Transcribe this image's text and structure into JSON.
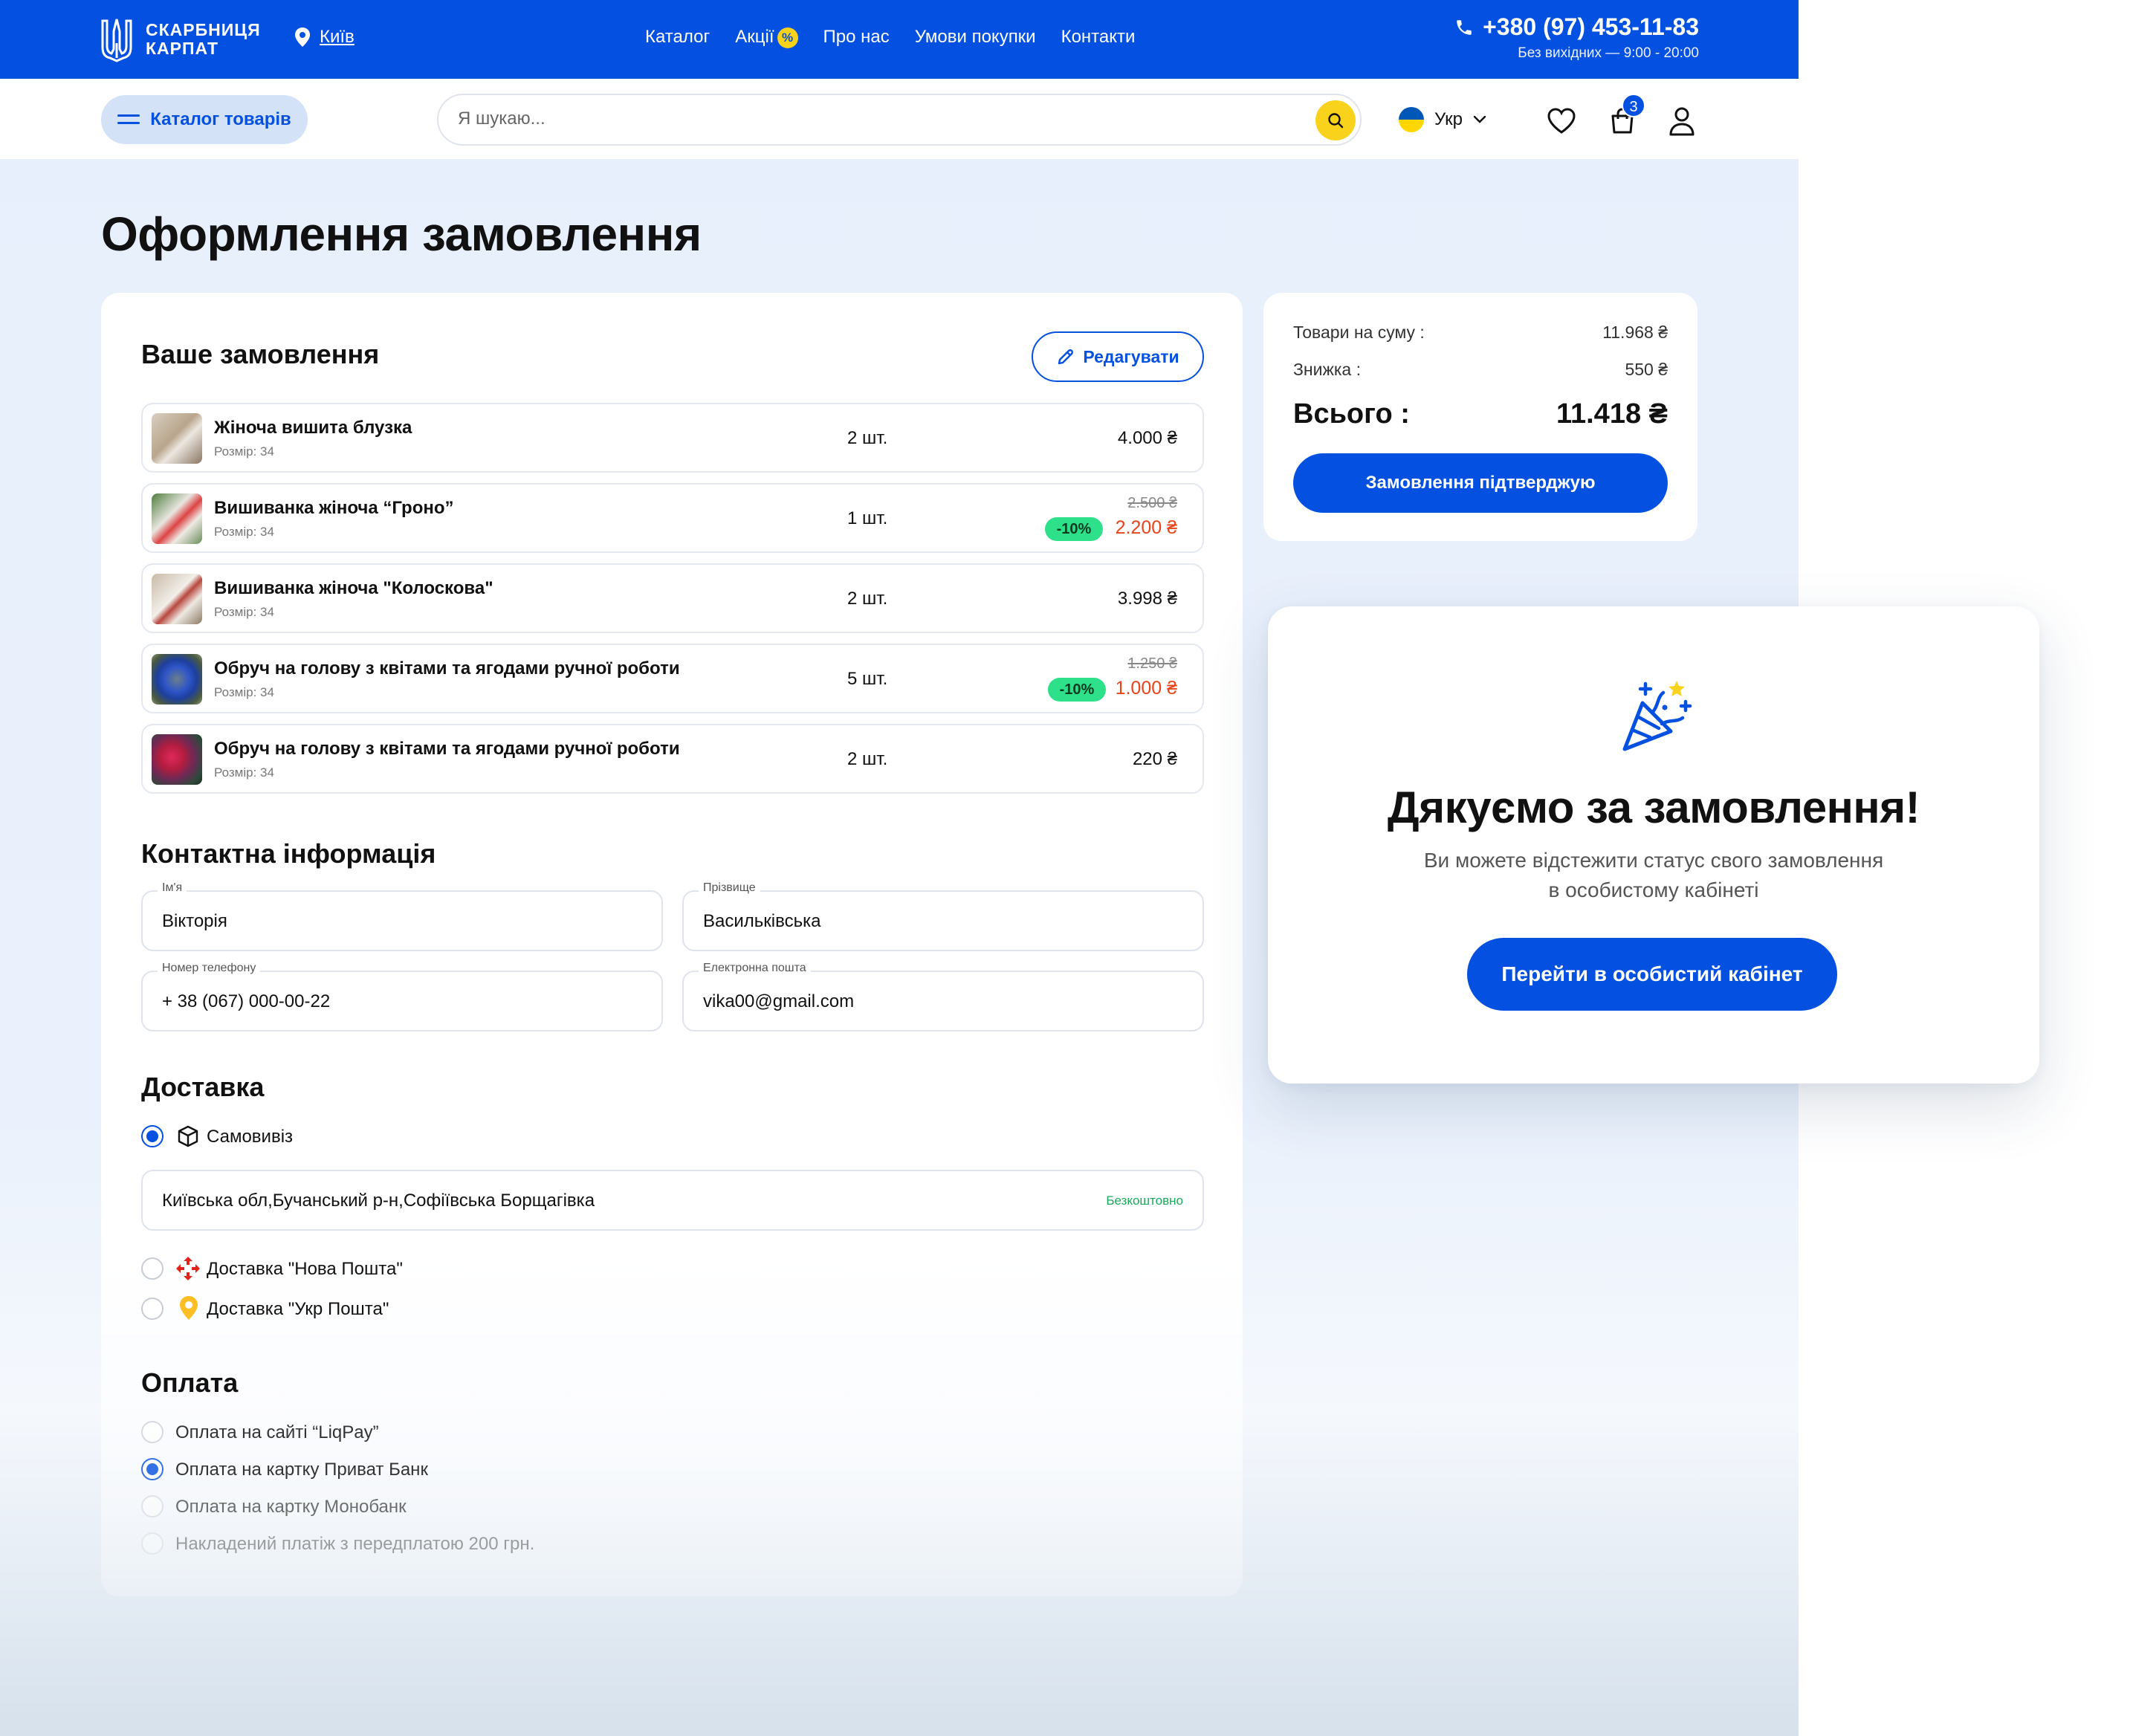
{
  "header": {
    "logo_line1": "СКАРБНИЦЯ",
    "logo_line2": "КАРПАТ",
    "city": "Київ",
    "nav": [
      "Каталог",
      "Акції",
      "Про нас",
      "Умови покупки",
      "Контакти"
    ],
    "sale_badge": "%",
    "phone": "+380 (97) 453-11-83",
    "hours": "Без вихідних — 9:00 - 20:00"
  },
  "toolbar": {
    "catalog_button": "Каталог товарів",
    "search_placeholder": "Я шукаю...",
    "language": "Укр",
    "cart_count": "3"
  },
  "page_title": "Оформлення замовлення",
  "order": {
    "title": "Ваше замовлення",
    "edit_button": "Редагувати",
    "items": [
      {
        "name": "Жіноча вишита блузка",
        "size": "Розмір: 34",
        "qty": "2 шт.",
        "price": "4.000 ₴",
        "old_price": "",
        "discount": ""
      },
      {
        "name": "Вишиванка жіноча “Гроно”",
        "size": "Розмір: 34",
        "qty": "1 шт.",
        "price": "2.200 ₴",
        "old_price": "2.500 ₴",
        "discount": "-10%"
      },
      {
        "name": "Вишиванка жіноча \"Колоскова\"",
        "size": "Розмір: 34",
        "qty": "2 шт.",
        "price": "3.998 ₴",
        "old_price": "",
        "discount": ""
      },
      {
        "name": "Обруч на голову з квітами та ягодами ручної роботи",
        "size": "Розмір: 34",
        "qty": "5 шт.",
        "price": "1.000 ₴",
        "old_price": "1.250 ₴",
        "discount": "-10%"
      },
      {
        "name": "Обруч на голову з квітами та ягодами ручної роботи",
        "size": "Розмір: 34",
        "qty": "2 шт.",
        "price": "220 ₴",
        "old_price": "",
        "discount": ""
      }
    ]
  },
  "contact": {
    "title": "Контактна інформація",
    "first_name_label": "Ім'я",
    "first_name": "Вікторія",
    "last_name_label": "Прізвище",
    "last_name": "Васильківська",
    "phone_label": "Номер телефону",
    "phone": "+ 38 (067) 000-00-22",
    "email_label": "Електронна пошта",
    "email": "vika00@gmail.com"
  },
  "delivery": {
    "title": "Доставка",
    "pickup": "Самовивіз",
    "address": "Київська обл,Бучанський р-н,Софіївська Борщагівка",
    "free": "Безкоштовно",
    "nova_poshta": "Доставка \"Нова Пошта\"",
    "ukr_poshta": "Доставка \"Укр Пошта\""
  },
  "payment": {
    "title": "Оплата",
    "options": [
      "Оплата на сайті “LiqPay”",
      "Оплата на картку Приват Банк",
      "Оплата на картку Монобанк",
      "Накладений платіж з передплатою 200 грн."
    ]
  },
  "summary": {
    "subtotal_label": "Товари на суму :",
    "subtotal": "11.968 ₴",
    "discount_label": "Знижка :",
    "discount": "550 ₴",
    "total_label": "Всього :",
    "total": "11.418 ₴",
    "confirm_button": "Замовлення підтверджую"
  },
  "modal": {
    "title": "Дякуємо за замовлення!",
    "text_line1": "Ви можете відстежити статус свого замовлення",
    "text_line2": "в особистому кабінеті",
    "button": "Перейти в особистий кабінет"
  },
  "colors": {
    "primary": "#0450e0",
    "accent_yellow": "#f8d21b",
    "discount_green": "#2ee089",
    "sale_red": "#e8431b"
  }
}
